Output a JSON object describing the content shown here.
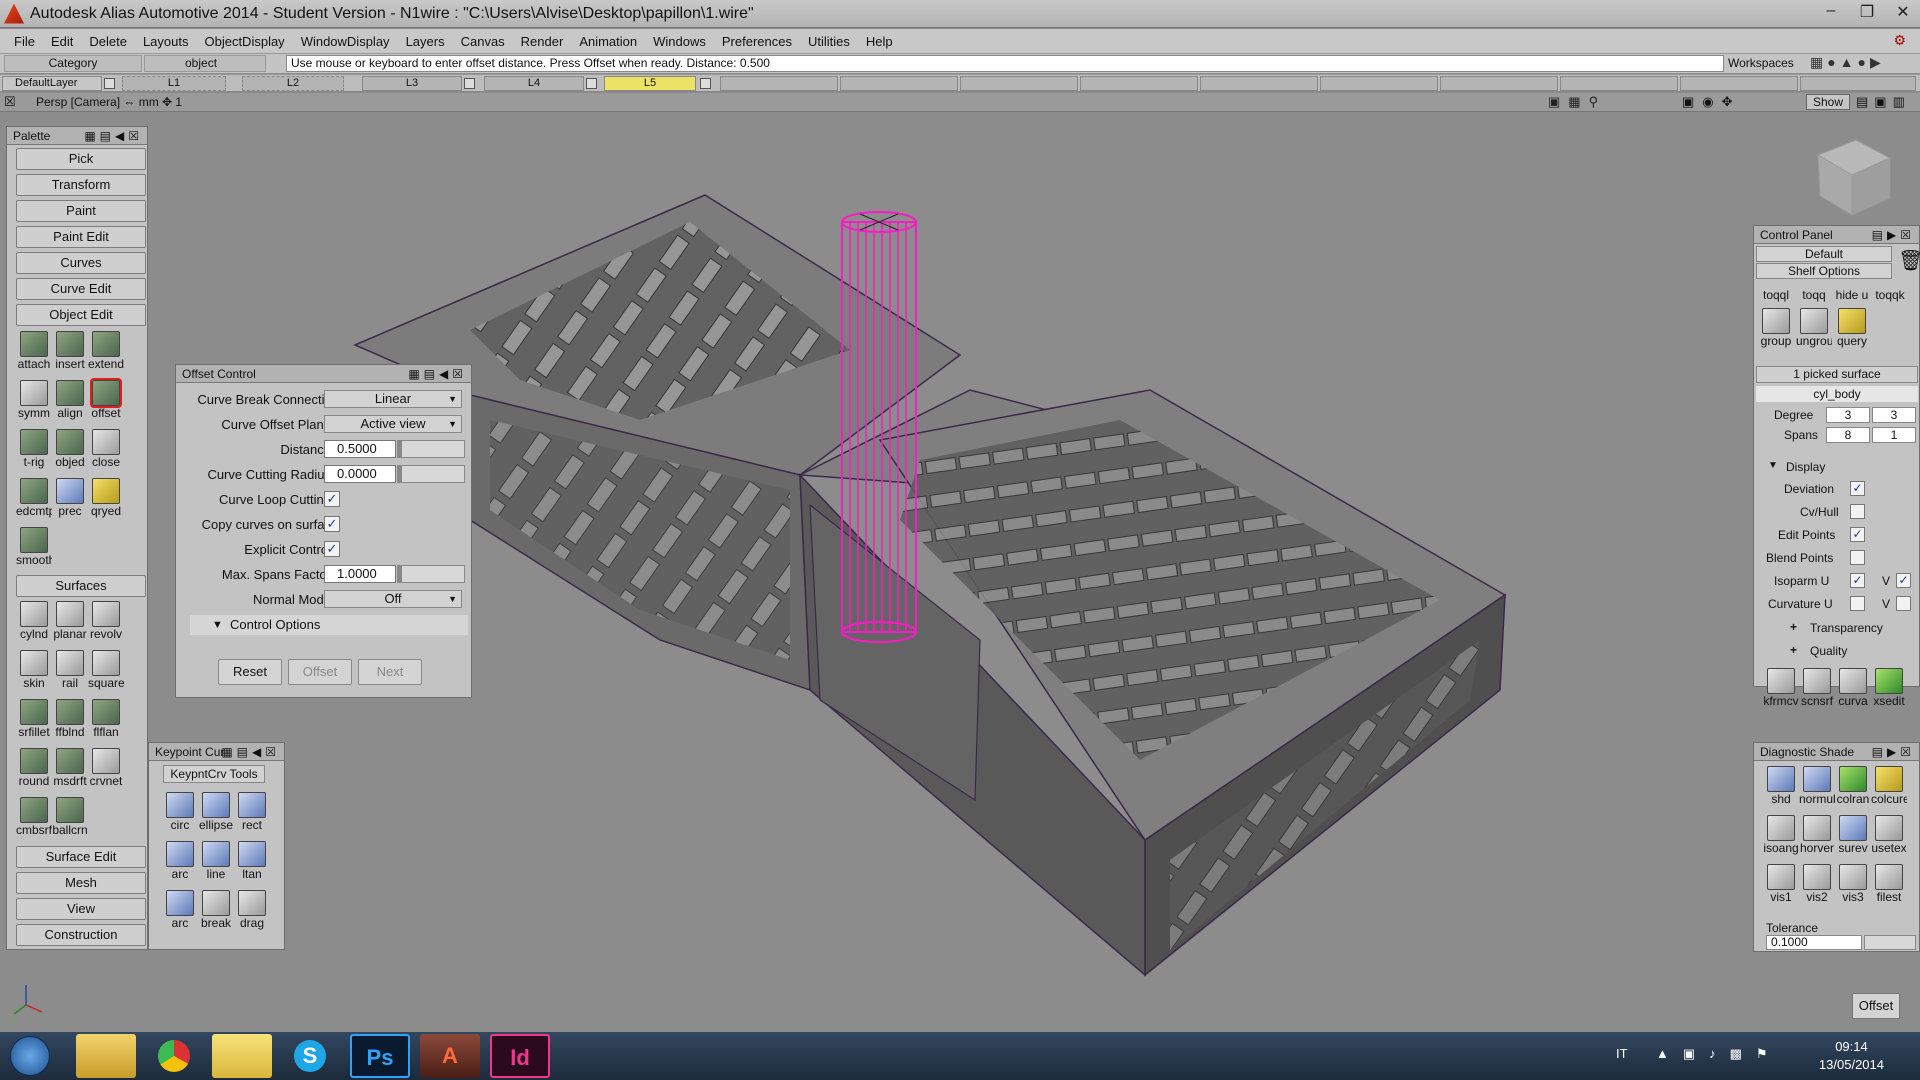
{
  "window": {
    "title": "Autodesk Alias Automotive 2014   - Student Version   - N1wire : \"C:\\Users\\Alvise\\Desktop\\papillon\\1.wire\""
  },
  "menu": [
    "File",
    "Edit",
    "Delete",
    "Layouts",
    "ObjectDisplay",
    "WindowDisplay",
    "Layers",
    "Canvas",
    "Render",
    "Animation",
    "Windows",
    "Preferences",
    "Utilities",
    "Help"
  ],
  "prompt": {
    "category": "Category",
    "object": "object",
    "message": "Use mouse or keyboard to enter offset distance. Press Offset when ready. Distance: 0.500",
    "workspaces": "Workspaces"
  },
  "layers": [
    "DefaultLayer",
    "L1",
    "L2",
    "L3",
    "L4",
    "L5"
  ],
  "view": {
    "label": "Persp [Camera] ⇔ mm   ✥ 1",
    "show": "Show"
  },
  "palette": {
    "title": "Palette",
    "buttons": [
      "Pick",
      "Transform",
      "Paint",
      "Paint Edit",
      "Curves",
      "Curve Edit",
      "Object Edit"
    ],
    "object_edit_tools": [
      "attach",
      "insert",
      "extend",
      "symm",
      "align",
      "offset",
      "t-rig",
      "objed",
      "close",
      "edcmtpt",
      "prec",
      "qryed",
      "smooth"
    ],
    "surfaces_label": "Surfaces",
    "surface_tools": [
      "cylnd",
      "planar",
      "revolv",
      "skin",
      "rail",
      "square",
      "srfillet",
      "ffblnd",
      "flflan",
      "round",
      "msdrft",
      "crvnet",
      "cmbsrf",
      "ballcrn"
    ],
    "bottom_buttons": [
      "Surface Edit",
      "Mesh",
      "View",
      "Construction"
    ]
  },
  "keypoint": {
    "title": "Keypoint Cur",
    "tab": "KeypntCrv Tools",
    "tools": [
      "circ",
      "ellipse",
      "rect",
      "arc",
      "line",
      "ltan",
      "arc",
      "break",
      "drag"
    ]
  },
  "offset_control": {
    "title": "Offset Control",
    "curve_break_label": "Curve Break Connectic",
    "curve_break_value": "Linear",
    "offset_plane_label": "Curve Offset Plane",
    "offset_plane_value": "Active view",
    "distance_label": "Distance",
    "distance_value": "0.5000",
    "cutting_radius_label": "Curve Cutting Radius",
    "cutting_radius_value": "0.0000",
    "loop_cutting_label": "Curve Loop Cutting",
    "copy_curves_label": "Copy curves on surfac",
    "explicit_label": "Explicit Control",
    "max_spans_label": "Max. Spans Factor",
    "max_spans_value": "1.0000",
    "normal_mode_label": "Normal Mode",
    "normal_mode_value": "Off",
    "control_options_label": "Control Options",
    "reset": "Reset",
    "offset": "Offset",
    "next": "Next"
  },
  "control_panel": {
    "title": "Control Panel",
    "preset": "Default",
    "shelf": "Shelf Options",
    "shelf_tools": [
      "toqql",
      "toqq",
      "hide u",
      "toqqk",
      "group",
      "ungroup",
      "query"
    ],
    "picked": "1 picked surface",
    "name": "cyl_body",
    "degree_label": "Degree",
    "degree_u": "3",
    "degree_v": "3",
    "spans_label": "Spans",
    "spans_u": "8",
    "spans_v": "1",
    "display_label": "Display",
    "deviation": "Deviation",
    "cvhull": "Cv/Hull",
    "edit_points": "Edit Points",
    "blend_points": "Blend Points",
    "isoparm": "Isoparm U",
    "curvature": "Curvature U",
    "v_label": "V",
    "transparency": "Transparency",
    "quality": "Quality",
    "bottom_tools": [
      "kfrmcv",
      "scnsrf",
      "curva",
      "xsedit"
    ]
  },
  "diagnostic": {
    "title": "Diagnostic Shade",
    "tools": [
      "shd",
      "normul",
      "colran",
      "colcurev",
      "isoang",
      "horver",
      "surev",
      "usetex",
      "vis1",
      "vis2",
      "vis3",
      "filest"
    ],
    "tolerance_label": "Tolerance",
    "tolerance_value": "0.1000"
  },
  "offset_button": "Offset",
  "taskbar": {
    "lang": "IT",
    "time": "09:14",
    "date": "13/05/2014",
    "apps": [
      "Ps",
      "A",
      "Id"
    ]
  }
}
